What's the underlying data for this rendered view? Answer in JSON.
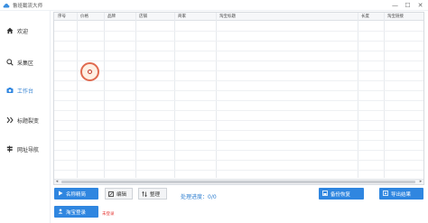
{
  "app": {
    "title": "鲁班截流大师"
  },
  "window": {
    "minimize": "—",
    "maximize": "☐",
    "close": "✕"
  },
  "sidebar": {
    "items": [
      {
        "label": "欢迎",
        "icon": "home-icon"
      },
      {
        "label": "采集区",
        "icon": "search-icon"
      },
      {
        "label": "工作台",
        "icon": "camera-icon",
        "active": true
      },
      {
        "label": "标题裂变",
        "icon": "split-icon"
      },
      {
        "label": "网址导航",
        "icon": "signpost-icon"
      }
    ]
  },
  "table": {
    "columns": [
      "序号",
      "价格",
      "品牌",
      "店铺",
      "商家",
      "淘宝标题",
      "长度",
      "淘宝链接"
    ]
  },
  "actions": {
    "brand_search": "名称精简",
    "edit": "编辑",
    "sort": "整理",
    "progress_label": "处理进度：",
    "progress_value": "0/0",
    "backup_restore": "备份恢复",
    "export_results": "导出结果",
    "taobao_login": "淘宝登录",
    "login_status": "未登录"
  },
  "colors": {
    "accent": "#2f86e0",
    "warning": "#e53935"
  }
}
